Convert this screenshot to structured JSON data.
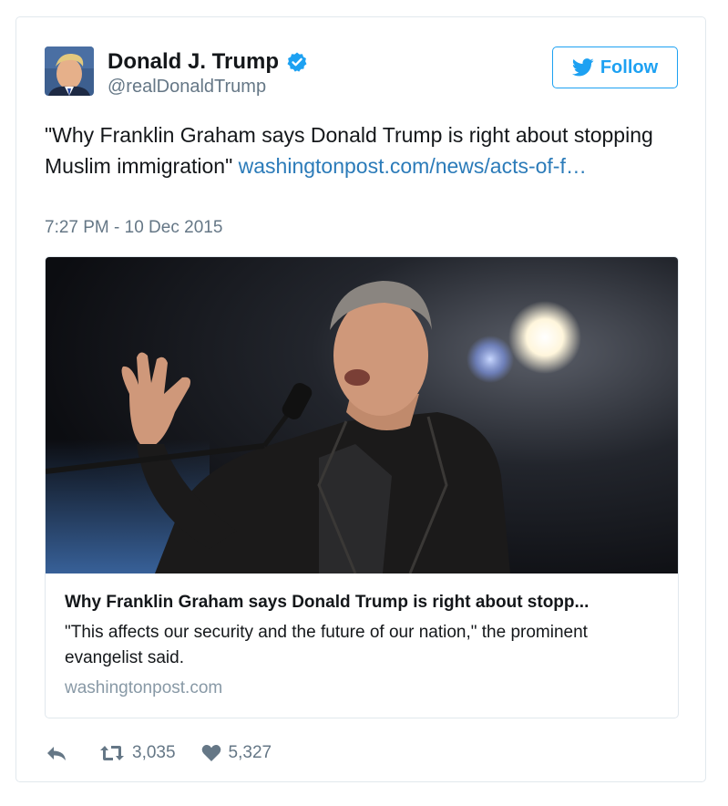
{
  "author": {
    "name": "Donald J. Trump",
    "handle": "@realDonaldTrump",
    "verified": true
  },
  "follow_button": {
    "label": "Follow",
    "icon": "twitter-bird-icon"
  },
  "tweet": {
    "text": "\"Why Franklin Graham says Donald Trump is right about stopping Muslim immigration\" ",
    "link_text": "washingtonpost.com/news/acts-of-f…",
    "timestamp": "7:27 PM - 10 Dec 2015"
  },
  "card": {
    "image_subject": "speaker-at-microphone-photo",
    "title": "Why Franklin Graham says Donald Trump is right about stopp...",
    "description": "\"This affects our security and the future of our nation,\" the prominent evangelist said.",
    "domain": "washingtonpost.com"
  },
  "actions": {
    "reply_icon": "reply-icon",
    "retweet_icon": "retweet-icon",
    "retweet_count": "3,035",
    "like_icon": "heart-icon",
    "like_count": "5,327"
  },
  "colors": {
    "accent": "#1da1f2",
    "link": "#2b7bb9",
    "muted": "#657786",
    "border": "#e1e8ed"
  }
}
